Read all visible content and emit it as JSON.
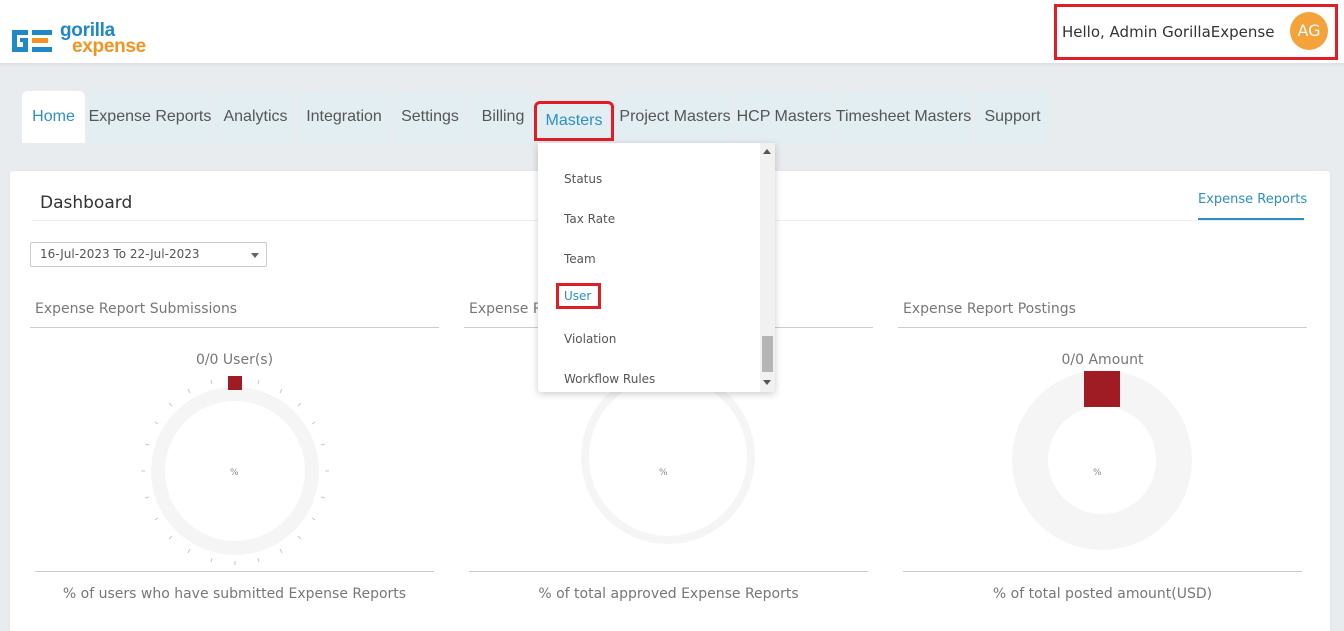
{
  "brand": {
    "line1": "gorilla",
    "line2": "expense",
    "primary_color": "#1e88c8",
    "accent_color": "#f29422"
  },
  "user": {
    "greeting": "Hello, Admin GorillaExpense",
    "initials": "AG"
  },
  "tabs": [
    {
      "label": "Home"
    },
    {
      "label": "Expense Reports"
    },
    {
      "label": "Analytics"
    },
    {
      "label": "Integration"
    },
    {
      "label": "Settings"
    },
    {
      "label": "Billing"
    },
    {
      "label": "Masters"
    },
    {
      "label": "Project Masters"
    },
    {
      "label": "HCP Masters"
    },
    {
      "label": "Timesheet Masters"
    },
    {
      "label": "Support"
    }
  ],
  "dashboard": {
    "title": "Dashboard",
    "expense_reports_link": "Expense Reports",
    "date_range": "16-Jul-2023 To 22-Jul-2023",
    "panels": [
      {
        "title": "Expense Report Submissions",
        "value": "0/0 User(s)",
        "center": "%",
        "footer": "% of users who have submitted Expense Reports"
      },
      {
        "title": "Expense R",
        "value": "",
        "center": "%",
        "footer": "% of total approved Expense Reports"
      },
      {
        "title": "Expense Report Postings",
        "value": "0/0 Amount",
        "center": "%",
        "footer": "% of total posted amount(USD)"
      }
    ]
  },
  "masters_menu": {
    "items": [
      {
        "label": "Status"
      },
      {
        "label": "Tax Rate"
      },
      {
        "label": "Team"
      },
      {
        "label": "User"
      },
      {
        "label": "Violation"
      },
      {
        "label": "Workflow Rules"
      }
    ]
  },
  "colors": {
    "highlight": "#e01e26",
    "link": "#2d8fc4",
    "marker": "#a01c24",
    "avatar": "#f4a23a"
  }
}
